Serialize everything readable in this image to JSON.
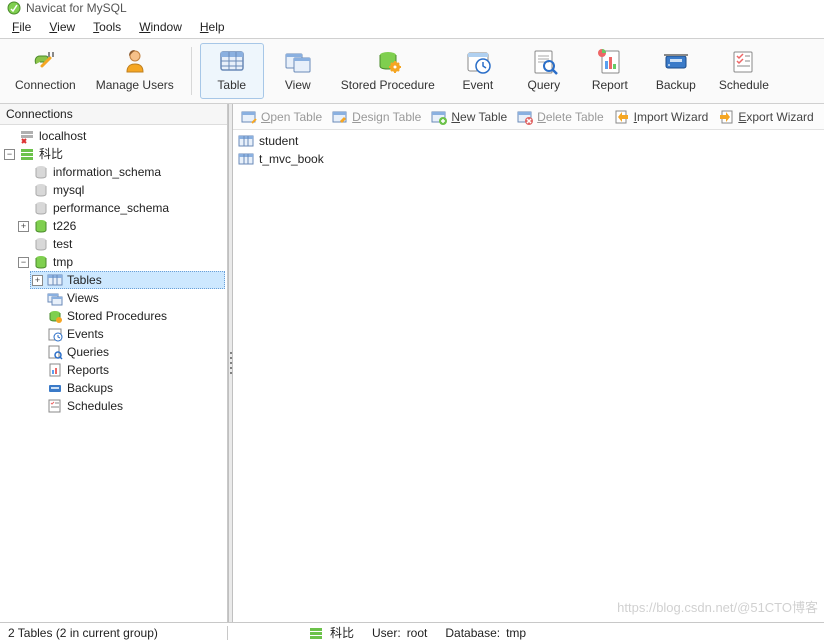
{
  "title": "Navicat for MySQL",
  "menubar": [
    {
      "label": "File",
      "accel": "F"
    },
    {
      "label": "View",
      "accel": "V"
    },
    {
      "label": "Tools",
      "accel": "T"
    },
    {
      "label": "Window",
      "accel": "W"
    },
    {
      "label": "Help",
      "accel": "H"
    }
  ],
  "main_toolbar": [
    {
      "name": "connection",
      "label": "Connection",
      "icon": "plug",
      "selected": false
    },
    {
      "name": "manage-users",
      "label": "Manage Users",
      "icon": "user",
      "selected": false
    },
    {
      "sep": true
    },
    {
      "name": "table",
      "label": "Table",
      "icon": "table",
      "selected": true
    },
    {
      "name": "view",
      "label": "View",
      "icon": "view",
      "selected": false
    },
    {
      "name": "storedproc",
      "label": "Stored Procedure",
      "icon": "sproc",
      "selected": false
    },
    {
      "name": "event",
      "label": "Event",
      "icon": "event",
      "selected": false
    },
    {
      "name": "query",
      "label": "Query",
      "icon": "query",
      "selected": false
    },
    {
      "name": "report",
      "label": "Report",
      "icon": "report",
      "selected": false
    },
    {
      "name": "backup",
      "label": "Backup",
      "icon": "backup",
      "selected": false
    },
    {
      "name": "schedule",
      "label": "Schedule",
      "icon": "schedule",
      "selected": false
    }
  ],
  "object_toolbar": [
    {
      "name": "open-table",
      "label": "Open Table",
      "accel": "O",
      "icon": "open",
      "disabled": true
    },
    {
      "name": "design-table",
      "label": "Design Table",
      "accel": "D",
      "icon": "design",
      "disabled": true
    },
    {
      "name": "new-table",
      "label": "New Table",
      "accel": "N",
      "icon": "new",
      "disabled": false
    },
    {
      "name": "delete-table",
      "label": "Delete Table",
      "accel": "D",
      "icon": "delete",
      "disabled": true
    },
    {
      "name": "import-wizard",
      "label": "Import Wizard",
      "accel": "I",
      "icon": "import",
      "disabled": false
    },
    {
      "name": "export-wizard",
      "label": "Export Wizard",
      "accel": "E",
      "icon": "export",
      "disabled": false
    }
  ],
  "sidebar": {
    "title": "Connections",
    "tree": {
      "localhost_label": "localhost",
      "kebi_label": "科比",
      "dbs": [
        {
          "name": "information_schema",
          "open": false,
          "gray": true
        },
        {
          "name": "mysql",
          "open": false,
          "gray": true
        },
        {
          "name": "performance_schema",
          "open": false,
          "gray": true
        },
        {
          "name": "t226",
          "open": false,
          "gray": false,
          "plus": true
        },
        {
          "name": "test",
          "open": false,
          "gray": true
        },
        {
          "name": "tmp",
          "open": true,
          "gray": false,
          "plus": false
        }
      ],
      "tmp_children": [
        {
          "name": "Tables",
          "icon": "table-sm",
          "selected": true,
          "plus": true
        },
        {
          "name": "Views",
          "icon": "view-sm"
        },
        {
          "name": "Stored Procedures",
          "icon": "sproc-sm"
        },
        {
          "name": "Events",
          "icon": "event-sm"
        },
        {
          "name": "Queries",
          "icon": "query-sm"
        },
        {
          "name": "Reports",
          "icon": "report-sm"
        },
        {
          "name": "Backups",
          "icon": "backup-sm"
        },
        {
          "name": "Schedules",
          "icon": "schedule-sm"
        }
      ]
    }
  },
  "object_list": [
    {
      "name": "student"
    },
    {
      "name": "t_mvc_book"
    }
  ],
  "statusbar": {
    "left": "2 Tables (2 in current group)",
    "conn": "科比",
    "user_label": "User:",
    "user": "root",
    "db_label": "Database:",
    "db": "tmp"
  },
  "watermark": "https://blog.csdn.net/@51CTO博客"
}
